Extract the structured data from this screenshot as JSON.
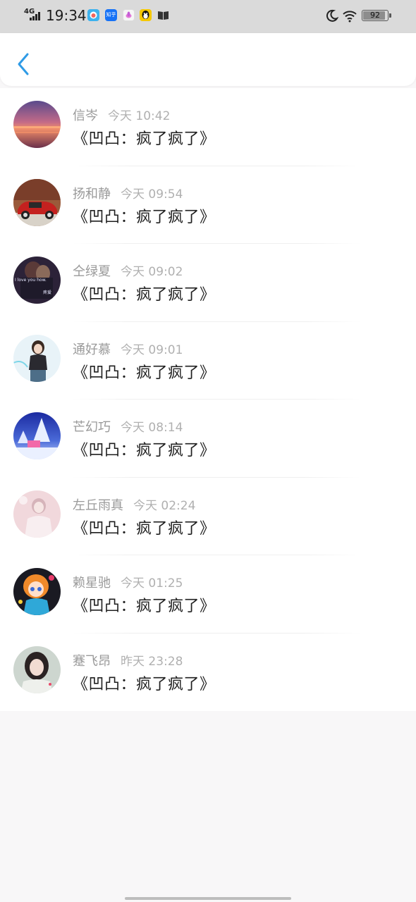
{
  "status_bar": {
    "network": "4G",
    "time": "19:34",
    "app_icons": [
      "weather-icon",
      "zhihu-icon",
      "lotus-icon",
      "qq-icon",
      "book-icon"
    ],
    "zhihu_label": "知乎",
    "battery": "92",
    "battery_level": 0.92
  },
  "header": {
    "back_icon": "chevron-left-icon",
    "accent_color": "#2f9be6"
  },
  "messages": [
    {
      "name": "信岑",
      "time": "今天 10:42",
      "text": "《凹凸：疯了疯了》",
      "avatar": "sunset-avatar"
    },
    {
      "name": "扬和静",
      "time": "今天 09:54",
      "text": "《凹凸：疯了疯了》",
      "avatar": "red-car-avatar"
    },
    {
      "name": "仝绿夏",
      "time": "今天 09:02",
      "text": "《凹凸：疯了疯了》",
      "avatar": "couple-avatar",
      "avatar_text_1": "I love you how.",
      "avatar_text_2": "疼爱"
    },
    {
      "name": "通好慕",
      "time": "今天 09:01",
      "text": "《凹凸：疯了疯了》",
      "avatar": "girl-avatar"
    },
    {
      "name": "芒幻巧",
      "time": "今天 08:14",
      "text": "《凹凸：疯了疯了》",
      "avatar": "winter-night-avatar"
    },
    {
      "name": "左丘雨真",
      "time": "今天 02:24",
      "text": "《凹凸：疯了疯了》",
      "avatar": "pink-portrait-avatar"
    },
    {
      "name": "赖星驰",
      "time": "今天 01:25",
      "text": "《凹凸：疯了疯了》",
      "avatar": "anime-girl-avatar"
    },
    {
      "name": "蹇飞昂",
      "time": "昨天 23:28",
      "text": "《凹凸：疯了疯了》",
      "avatar": "portrait-avatar"
    }
  ]
}
